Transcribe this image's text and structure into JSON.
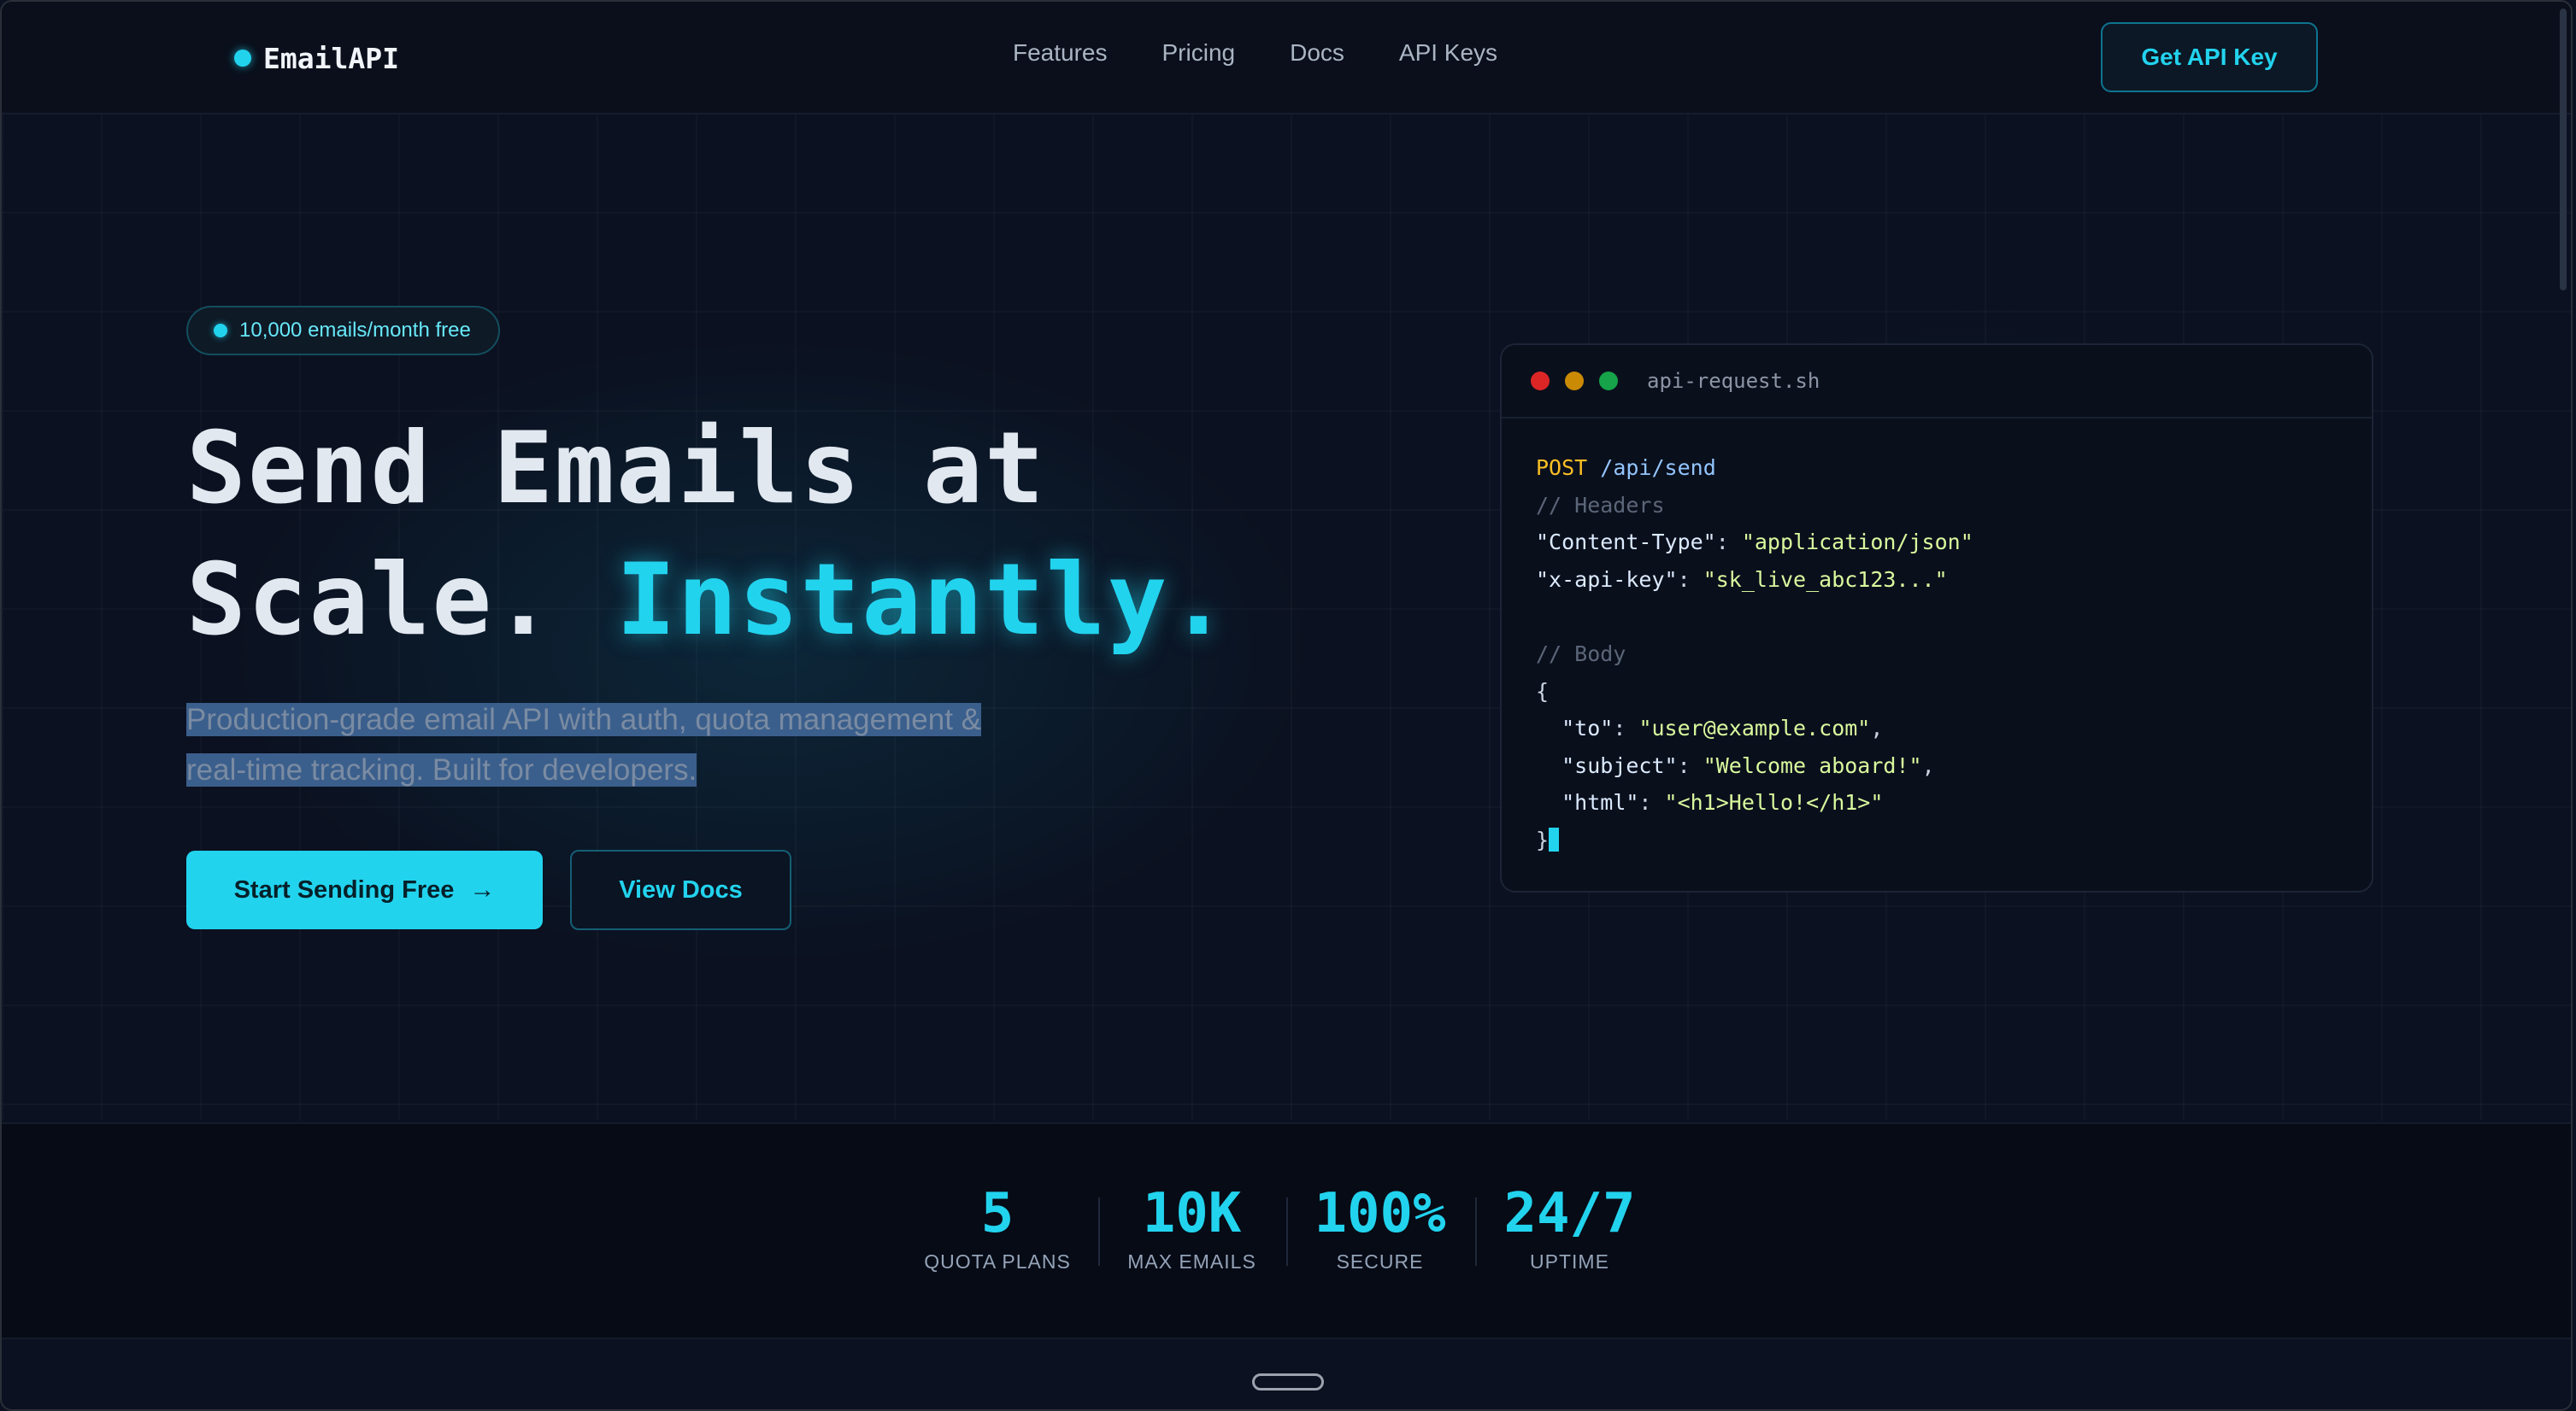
{
  "brand": {
    "name": "EmailAPI"
  },
  "nav": {
    "links": [
      "Features",
      "Pricing",
      "Docs",
      "API Keys"
    ],
    "cta_label": "Get API Key"
  },
  "hero": {
    "badge": "10,000 emails/month free",
    "headline_line1": "Send Emails at",
    "headline_line2_plain": "Scale. ",
    "headline_line2_accent": "Instantly.",
    "subtitle_line1": "Production-grade email API with auth, quota management &",
    "subtitle_line2": "real-time tracking. Built for developers.",
    "primary_button": "Start Sending Free",
    "primary_arrow": "→",
    "secondary_button": "View Docs"
  },
  "code_window": {
    "filename": "api-request.sh",
    "method": "POST",
    "path": "/api/send",
    "comment_headers": "// Headers",
    "header1_key": "\"Content-Type\"",
    "header1_value": "\"application/json\"",
    "header2_key": "\"x-api-key\"",
    "header2_value": "\"sk_live_abc123...\"",
    "comment_body": "// Body",
    "open_brace": "{",
    "body_to_key": "\"to\"",
    "body_to_value": "\"user@example.com\"",
    "body_subject_key": "\"subject\"",
    "body_subject_value": "\"Welcome aboard!\"",
    "body_html_key": "\"html\"",
    "body_html_value": "\"<h1>Hello!</h1>\"",
    "close_brace": "}"
  },
  "stats": [
    {
      "value": "5",
      "label": "QUOTA PLANS"
    },
    {
      "value": "10K",
      "label": "MAX EMAILS"
    },
    {
      "value": "100%",
      "label": "SECURE"
    },
    {
      "value": "24/7",
      "label": "UPTIME"
    }
  ],
  "colors": {
    "accent": "#22d3ee",
    "background": "#0b1120",
    "primary_button_bg": "#22d3ee",
    "selection_highlight": "#3b5f8c"
  }
}
